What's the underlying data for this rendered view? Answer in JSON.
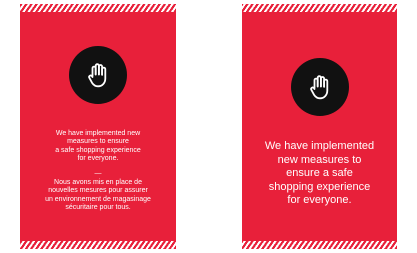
{
  "theme": {
    "accent_red": "#e8203a",
    "icon_circle": "#111111",
    "text_color": "#ffffff"
  },
  "cards": [
    {
      "icon": "raised-hand-icon",
      "message_en": "We have implemented new\nmeasures to ensure\na safe shopping experience\nfor everyone.",
      "divider": "—",
      "message_fr": "Nous avons mis en place de\nnouvelles mesures pour assurer\nun environnement de magasinage\nsécuritaire pour tous."
    },
    {
      "icon": "raised-hand-icon",
      "message_en": "We have implemented\nnew measures to\nensure a safe\nshopping experience\nfor everyone."
    }
  ]
}
